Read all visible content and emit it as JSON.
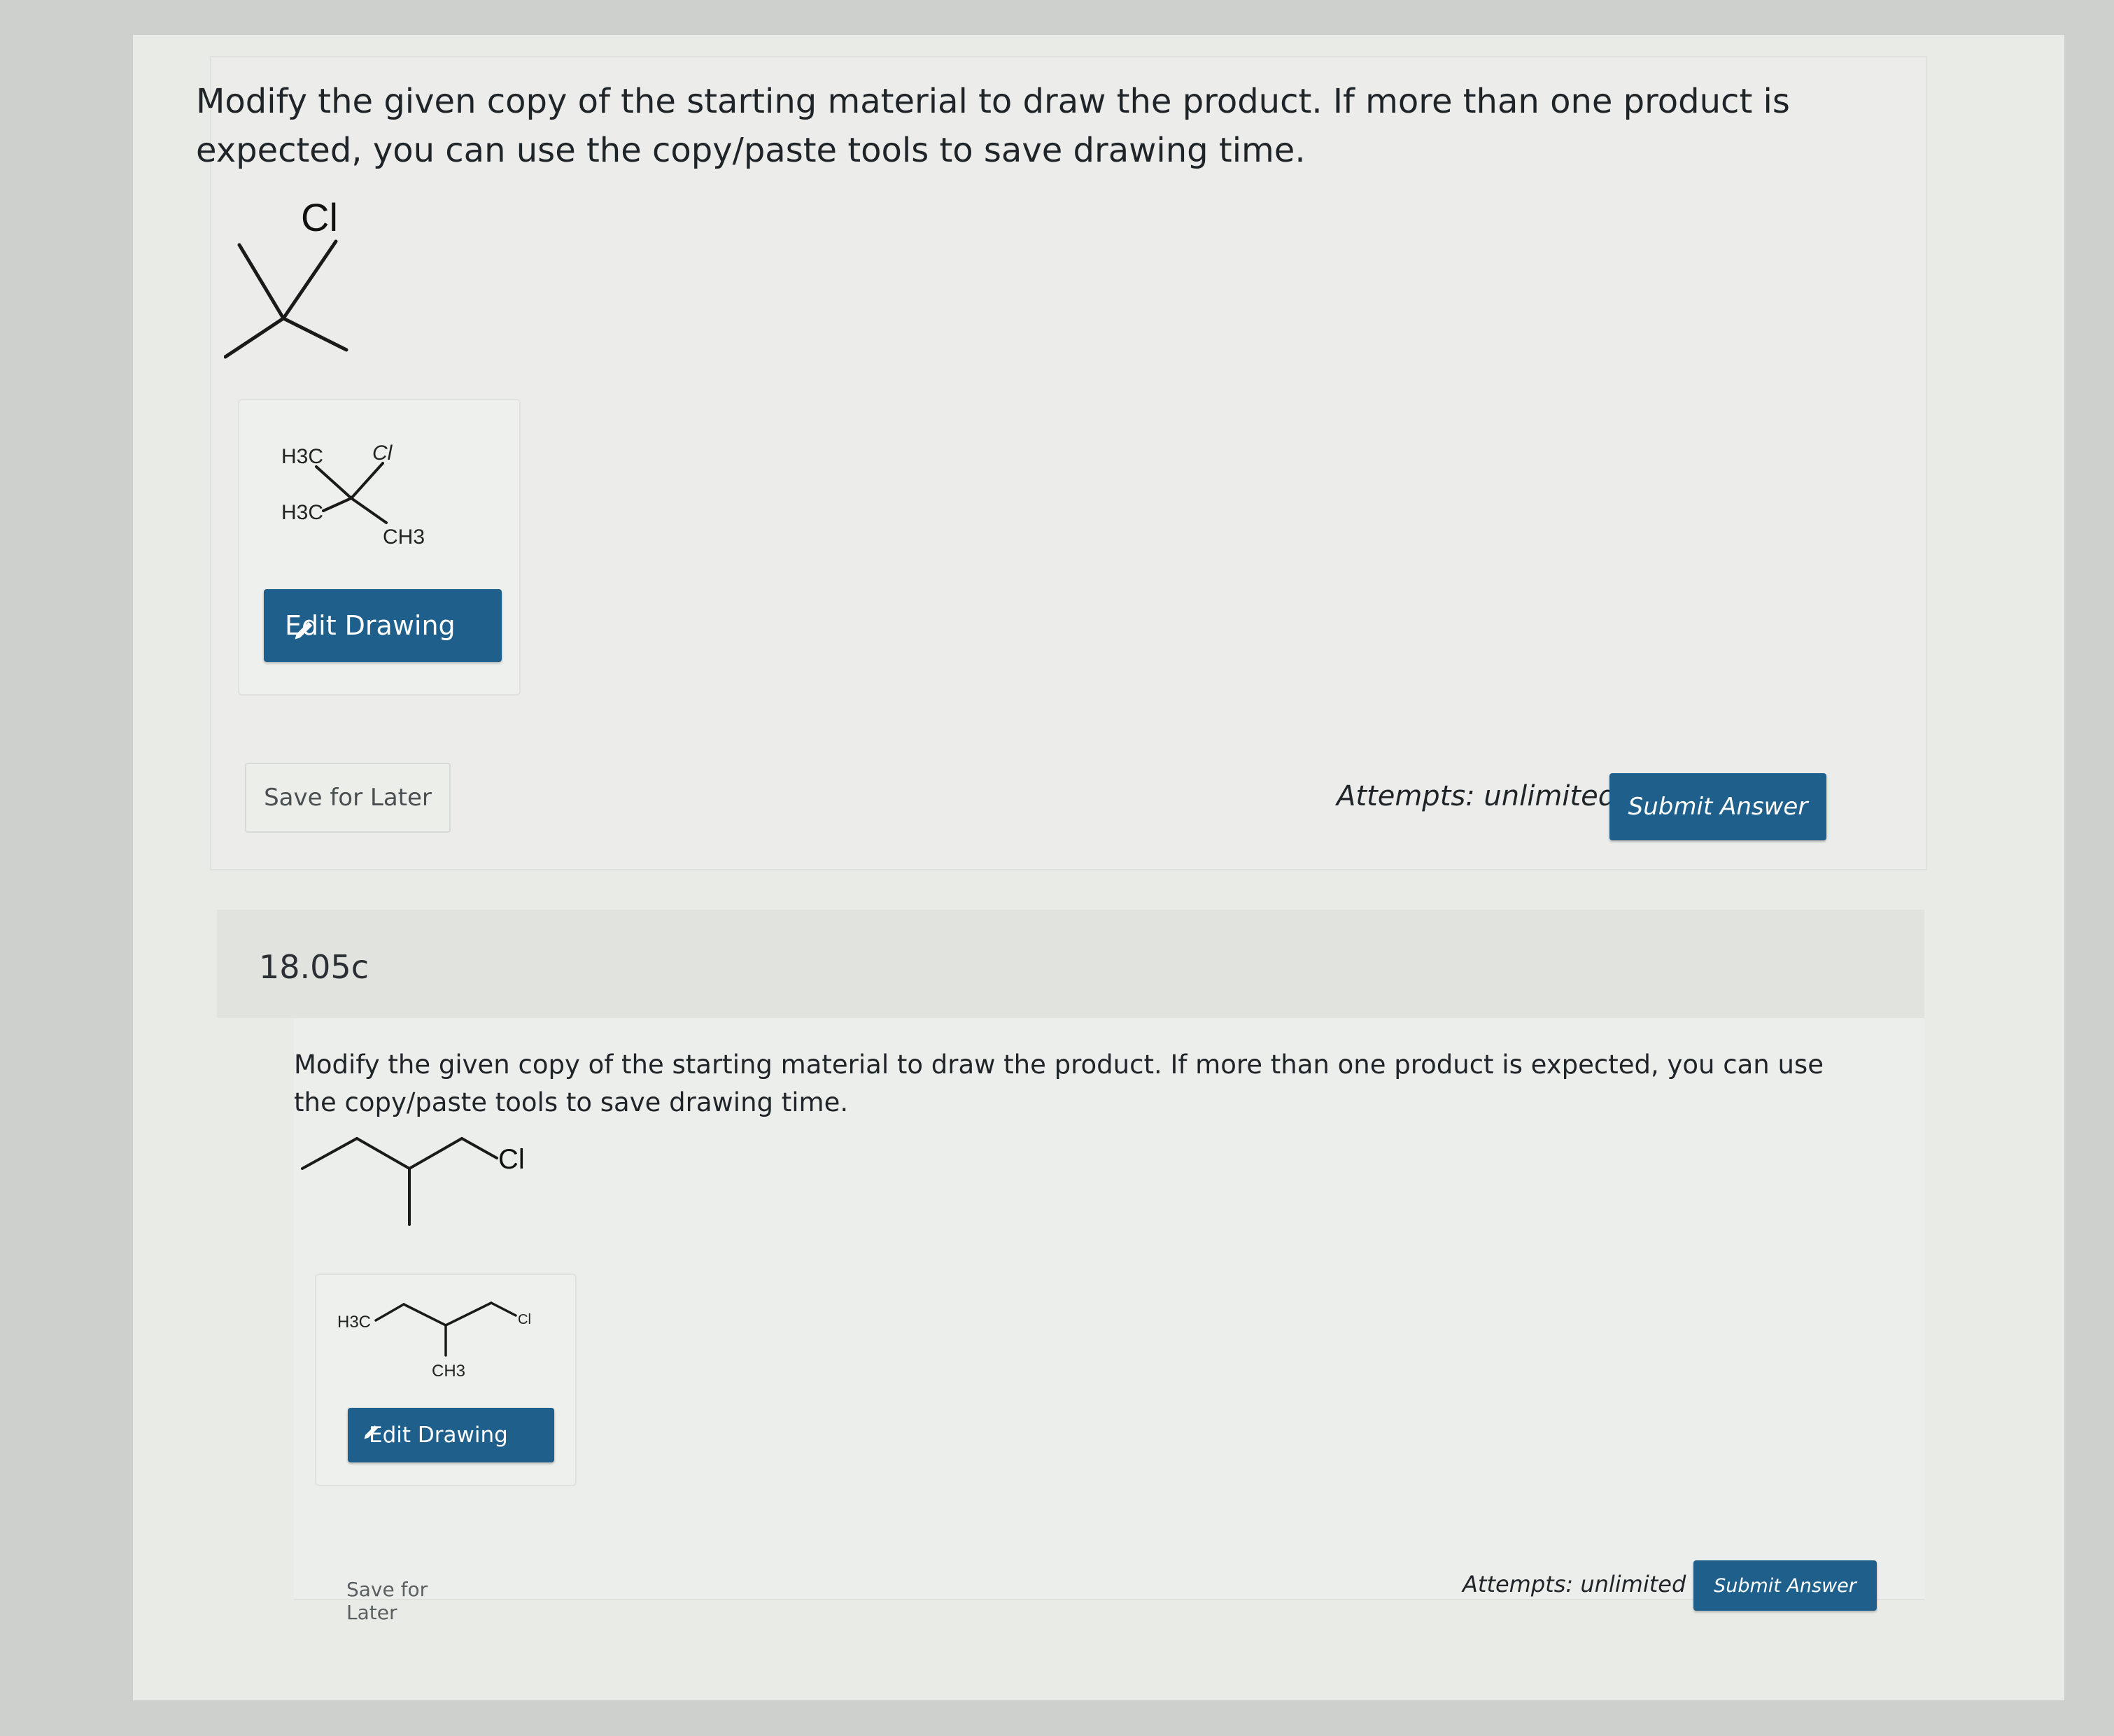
{
  "question_a": {
    "prompt": "Modify the given copy of the starting material to draw the product. If more than one product is expected, you can use the copy/paste tools to save drawing time.",
    "starting_material_label": "Cl",
    "drawing_labels": [
      "H3C",
      "Cl",
      "H3C",
      "CH3"
    ],
    "edit_label": "Edit Drawing",
    "save_label": "Save for Later",
    "attempts": "Attempts: unlimited",
    "submit_label": "Submit Answer"
  },
  "question_b": {
    "number": "18.05c",
    "prompt": "Modify the given copy of the starting material to draw the product. If more than one product is expected, you can use the copy/paste tools to save drawing time.",
    "starting_material_label": "Cl",
    "drawing_labels": [
      "H3C",
      "Cl",
      "CH3"
    ],
    "edit_label": "Edit Drawing",
    "save_label": "Save for Later",
    "attempts": "Attempts: unlimited",
    "submit_label": "Submit Answer"
  },
  "colors": {
    "primary_button": "#1f5f8b",
    "page": "#e9ebe7"
  },
  "icons": {
    "edit": "pencil-icon"
  }
}
